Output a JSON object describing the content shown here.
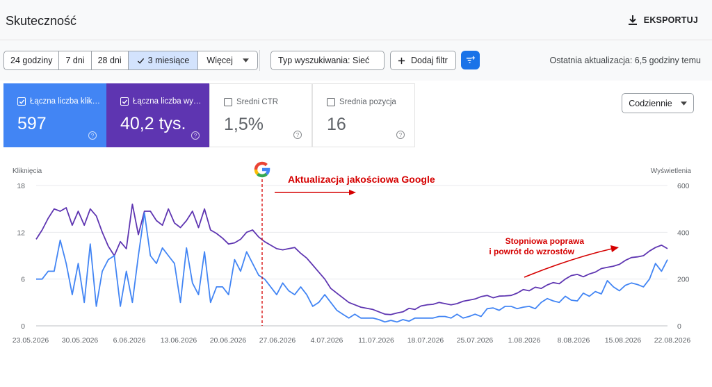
{
  "header": {
    "title": "Skuteczność",
    "export_label": "EKSPORTUJ"
  },
  "filters": {
    "ranges": [
      {
        "label": "24 godziny",
        "active": false
      },
      {
        "label": "7 dni",
        "active": false
      },
      {
        "label": "28 dni",
        "active": false
      },
      {
        "label": "3 miesiące",
        "active": true
      },
      {
        "label": "Więcej",
        "active": false
      }
    ],
    "search_type": "Typ wyszukiwania: Sieć",
    "add_filter": "Dodaj filtr",
    "last_update": "Ostatnia aktualizacja: 6,5 godziny temu"
  },
  "metrics": [
    {
      "label": "Łączna liczba klik…",
      "value": "597",
      "checked": true,
      "color": "#4285f4"
    },
    {
      "label": "Łączna liczba wy…",
      "value": "40,2 tys.",
      "checked": true,
      "color": "#5e35b1"
    },
    {
      "label": "Średni CTR",
      "value": "1,5%",
      "checked": false
    },
    {
      "label": "Średnia pozycja",
      "value": "16",
      "checked": false
    }
  ],
  "granularity": "Codziennie",
  "chart_data": {
    "type": "line",
    "left_axis_label": "Kliknięcia",
    "right_axis_label": "Wyświetlenia",
    "left_ylim": [
      0,
      18
    ],
    "left_ticks": [
      "0",
      "6",
      "12",
      "18"
    ],
    "right_ylim": [
      0,
      600
    ],
    "right_ticks": [
      "0",
      "200",
      "400",
      "600"
    ],
    "x_labels": [
      "23.05.2026",
      "30.05.2026",
      "6.06.2026",
      "13.06.2026",
      "20.06.2026",
      "27.06.2026",
      "4.07.2026",
      "11.07.2026",
      "18.07.2026",
      "25.07.2026",
      "1.08.2026",
      "8.08.2026",
      "15.08.2026",
      "22.08.2026"
    ],
    "series": [
      {
        "name": "Łączna liczba kliknięć",
        "axis": "left",
        "color": "#4285f4",
        "values": [
          6.0,
          6.0,
          7.0,
          7.0,
          11.0,
          8.0,
          4.0,
          8.0,
          3.0,
          10.5,
          2.5,
          7.0,
          8.5,
          9.0,
          2.5,
          7.0,
          3.0,
          9.0,
          14.5,
          9.0,
          8.0,
          10.0,
          9.0,
          8.0,
          3.0,
          10.0,
          5.5,
          4.0,
          9.5,
          3.0,
          5.0,
          5.0,
          4.0,
          8.5,
          7.0,
          9.5,
          8.0,
          6.5,
          6.0,
          5.0,
          4.0,
          5.5,
          4.5,
          4.0,
          5.0,
          4.0,
          2.5,
          3.0,
          4.0,
          3.0,
          2.0,
          1.5,
          1.0,
          1.5,
          1.0,
          1.0,
          1.0,
          0.8,
          0.5,
          0.7,
          0.5,
          0.8,
          0.6,
          1.0,
          1.0,
          1.0,
          1.0,
          1.2,
          1.2,
          1.0,
          1.5,
          1.0,
          1.2,
          1.5,
          1.2,
          2.2,
          2.3,
          2.0,
          2.5,
          2.5,
          2.2,
          2.4,
          2.5,
          2.2,
          3.0,
          3.5,
          3.2,
          3.0,
          3.8,
          3.3,
          3.2,
          4.2,
          3.8,
          4.4,
          4.1,
          5.8,
          5.0,
          4.5,
          5.2,
          5.5,
          5.3,
          5.0,
          6.0,
          8.0,
          7.0,
          8.5
        ]
      },
      {
        "name": "Łączna liczba wyświetleń",
        "axis": "right",
        "color": "#5e35b1",
        "values": [
          370,
          410,
          460,
          500,
          490,
          505,
          430,
          490,
          430,
          500,
          470,
          400,
          340,
          300,
          360,
          330,
          520,
          390,
          490,
          490,
          450,
          430,
          500,
          440,
          420,
          450,
          490,
          420,
          500,
          410,
          395,
          375,
          350,
          355,
          370,
          400,
          410,
          380,
          360,
          345,
          330,
          325,
          330,
          335,
          310,
          290,
          260,
          230,
          200,
          160,
          140,
          120,
          100,
          90,
          80,
          75,
          70,
          60,
          50,
          48,
          55,
          60,
          75,
          70,
          85,
          90,
          92,
          100,
          95,
          90,
          95,
          105,
          110,
          115,
          125,
          130,
          120,
          127,
          128,
          130,
          140,
          155,
          150,
          165,
          160,
          175,
          185,
          180,
          200,
          215,
          220,
          210,
          222,
          230,
          245,
          250,
          255,
          263,
          280,
          292,
          295,
          300,
          320,
          335,
          345,
          330
        ]
      }
    ],
    "annotation_main": "Aktualizacja jakościowa Google",
    "annotation_side_line1": "Stopniowa poprawa",
    "annotation_side_line2": "i powrót do wzrostów",
    "annotation_color": "#d50000",
    "grid": true
  }
}
